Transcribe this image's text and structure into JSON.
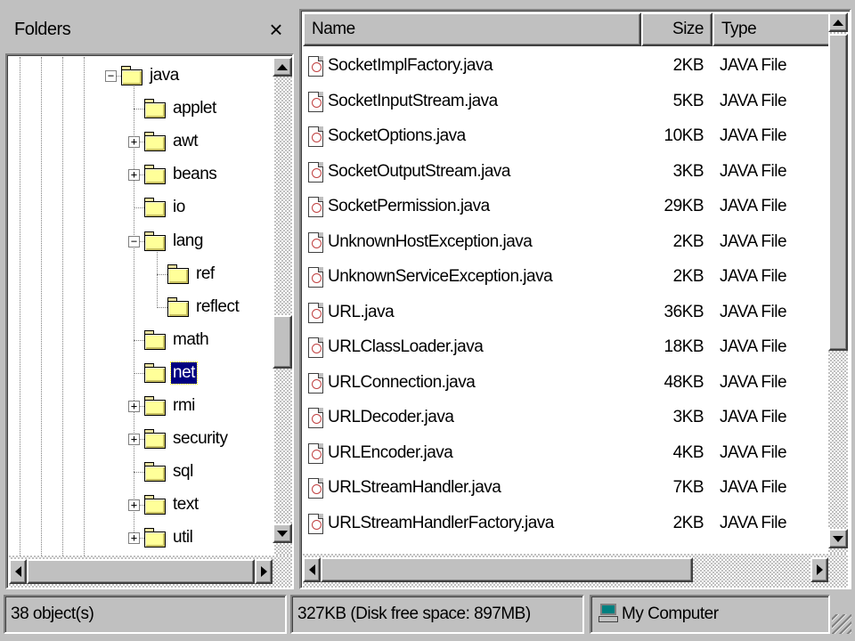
{
  "folders_pane": {
    "title": "Folders",
    "close_glyph": "×"
  },
  "tree": [
    {
      "label": "java",
      "level": 0,
      "expander": "minus",
      "open": false,
      "selected": false
    },
    {
      "label": "applet",
      "level": 1,
      "expander": "none",
      "open": false,
      "selected": false
    },
    {
      "label": "awt",
      "level": 1,
      "expander": "plus",
      "open": false,
      "selected": false
    },
    {
      "label": "beans",
      "level": 1,
      "expander": "plus",
      "open": false,
      "selected": false
    },
    {
      "label": "io",
      "level": 1,
      "expander": "none",
      "open": false,
      "selected": false
    },
    {
      "label": "lang",
      "level": 1,
      "expander": "minus",
      "open": false,
      "selected": false
    },
    {
      "label": "ref",
      "level": 2,
      "expander": "none",
      "open": false,
      "selected": false
    },
    {
      "label": "reflect",
      "level": 2,
      "expander": "none",
      "open": false,
      "selected": false
    },
    {
      "label": "math",
      "level": 1,
      "expander": "none",
      "open": false,
      "selected": false
    },
    {
      "label": "net",
      "level": 1,
      "expander": "none",
      "open": true,
      "selected": true
    },
    {
      "label": "rmi",
      "level": 1,
      "expander": "plus",
      "open": false,
      "selected": false
    },
    {
      "label": "security",
      "level": 1,
      "expander": "plus",
      "open": false,
      "selected": false
    },
    {
      "label": "sql",
      "level": 1,
      "expander": "none",
      "open": false,
      "selected": false
    },
    {
      "label": "text",
      "level": 1,
      "expander": "plus",
      "open": false,
      "selected": false
    },
    {
      "label": "util",
      "level": 1,
      "expander": "plus",
      "open": false,
      "selected": false
    }
  ],
  "columns": {
    "name": "Name",
    "size": "Size",
    "type": "Type"
  },
  "files": [
    {
      "name": "SocketImplFactory.java",
      "size": "2KB",
      "type": "JAVA File"
    },
    {
      "name": "SocketInputStream.java",
      "size": "5KB",
      "type": "JAVA File"
    },
    {
      "name": "SocketOptions.java",
      "size": "10KB",
      "type": "JAVA File"
    },
    {
      "name": "SocketOutputStream.java",
      "size": "3KB",
      "type": "JAVA File"
    },
    {
      "name": "SocketPermission.java",
      "size": "29KB",
      "type": "JAVA File"
    },
    {
      "name": "UnknownHostException.java",
      "size": "2KB",
      "type": "JAVA File"
    },
    {
      "name": "UnknownServiceException.java",
      "size": "2KB",
      "type": "JAVA File"
    },
    {
      "name": "URL.java",
      "size": "36KB",
      "type": "JAVA File"
    },
    {
      "name": "URLClassLoader.java",
      "size": "18KB",
      "type": "JAVA File"
    },
    {
      "name": "URLConnection.java",
      "size": "48KB",
      "type": "JAVA File"
    },
    {
      "name": "URLDecoder.java",
      "size": "3KB",
      "type": "JAVA File"
    },
    {
      "name": "URLEncoder.java",
      "size": "4KB",
      "type": "JAVA File"
    },
    {
      "name": "URLStreamHandler.java",
      "size": "7KB",
      "type": "JAVA File"
    },
    {
      "name": "URLStreamHandlerFactory.java",
      "size": "2KB",
      "type": "JAVA File"
    }
  ],
  "status": {
    "objects": "38 object(s)",
    "disk": "327KB (Disk free space: 897MB)",
    "location": "My Computer"
  },
  "colors": {
    "face": "#c0c0c0",
    "selection": "#000080",
    "folder": "#ffff99"
  },
  "icons": {
    "folder": "folder-icon",
    "java_file": "java-file-icon",
    "computer": "computer-icon"
  }
}
